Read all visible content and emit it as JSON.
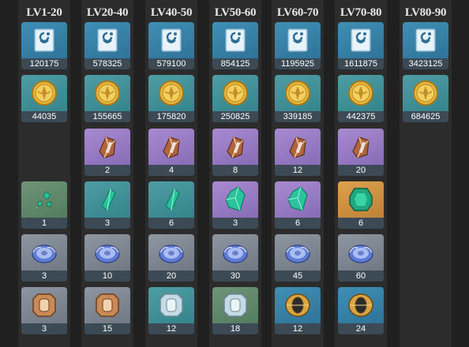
{
  "columns": [
    {
      "header": "LV1-20",
      "items": [
        {
          "row": 0,
          "icon": "exp-book-icon",
          "bg": "blue",
          "qty": "120175"
        },
        {
          "row": 1,
          "icon": "mora-coin-icon",
          "bg": "teal",
          "qty": "44035"
        },
        {
          "row": 3,
          "icon": "gem-sliver-icon",
          "bg": "green",
          "qty": "1"
        },
        {
          "row": 4,
          "icon": "nut-icon",
          "bg": "grey",
          "qty": "3"
        },
        {
          "row": 5,
          "icon": "guard-bronze-icon",
          "bg": "grey",
          "qty": "3"
        }
      ]
    },
    {
      "header": "LV20-40",
      "items": [
        {
          "row": 0,
          "icon": "exp-book-icon",
          "bg": "blue",
          "qty": "578325"
        },
        {
          "row": 1,
          "icon": "mora-coin-icon",
          "bg": "teal",
          "qty": "155665"
        },
        {
          "row": 2,
          "icon": "relic-ore-icon",
          "bg": "purple",
          "qty": "2"
        },
        {
          "row": 3,
          "icon": "gem-fragment-icon",
          "bg": "teal",
          "qty": "3"
        },
        {
          "row": 4,
          "icon": "nut-icon",
          "bg": "grey",
          "qty": "10"
        },
        {
          "row": 5,
          "icon": "guard-bronze-icon",
          "bg": "grey",
          "qty": "15"
        }
      ]
    },
    {
      "header": "LV40-50",
      "items": [
        {
          "row": 0,
          "icon": "exp-book-icon",
          "bg": "blue",
          "qty": "579100"
        },
        {
          "row": 1,
          "icon": "mora-coin-icon",
          "bg": "teal",
          "qty": "175820"
        },
        {
          "row": 2,
          "icon": "relic-ore-icon",
          "bg": "purple",
          "qty": "4"
        },
        {
          "row": 3,
          "icon": "gem-fragment-icon",
          "bg": "teal",
          "qty": "6"
        },
        {
          "row": 4,
          "icon": "nut-icon",
          "bg": "grey",
          "qty": "20"
        },
        {
          "row": 5,
          "icon": "guard-silver-icon",
          "bg": "teal",
          "qty": "12"
        }
      ]
    },
    {
      "header": "LV50-60",
      "items": [
        {
          "row": 0,
          "icon": "exp-book-icon",
          "bg": "blue",
          "qty": "854125"
        },
        {
          "row": 1,
          "icon": "mora-coin-icon",
          "bg": "teal",
          "qty": "250825"
        },
        {
          "row": 2,
          "icon": "relic-ore-icon",
          "bg": "purple",
          "qty": "8"
        },
        {
          "row": 3,
          "icon": "gem-chunk-icon",
          "bg": "purple",
          "qty": "3"
        },
        {
          "row": 4,
          "icon": "nut-icon",
          "bg": "grey",
          "qty": "30"
        },
        {
          "row": 5,
          "icon": "guard-silver-icon",
          "bg": "green",
          "qty": "18"
        }
      ]
    },
    {
      "header": "LV60-70",
      "items": [
        {
          "row": 0,
          "icon": "exp-book-icon",
          "bg": "blue",
          "qty": "1195925"
        },
        {
          "row": 1,
          "icon": "mora-coin-icon",
          "bg": "teal",
          "qty": "339185"
        },
        {
          "row": 2,
          "icon": "relic-ore-icon",
          "bg": "purple",
          "qty": "12"
        },
        {
          "row": 3,
          "icon": "gem-chunk-icon",
          "bg": "purple",
          "qty": "6"
        },
        {
          "row": 4,
          "icon": "nut-icon",
          "bg": "grey",
          "qty": "45"
        },
        {
          "row": 5,
          "icon": "guard-gold-icon",
          "bg": "blue",
          "qty": "12"
        }
      ]
    },
    {
      "header": "LV70-80",
      "items": [
        {
          "row": 0,
          "icon": "exp-book-icon",
          "bg": "blue",
          "qty": "1611875"
        },
        {
          "row": 1,
          "icon": "mora-coin-icon",
          "bg": "teal",
          "qty": "442375"
        },
        {
          "row": 2,
          "icon": "relic-ore-icon",
          "bg": "purple",
          "qty": "20"
        },
        {
          "row": 3,
          "icon": "gem-gemstone-icon",
          "bg": "gold",
          "qty": "6"
        },
        {
          "row": 4,
          "icon": "nut-icon",
          "bg": "grey",
          "qty": "60"
        },
        {
          "row": 5,
          "icon": "guard-gold-icon",
          "bg": "blue",
          "qty": "24"
        }
      ]
    },
    {
      "header": "LV80-90",
      "items": [
        {
          "row": 0,
          "icon": "exp-book-icon",
          "bg": "blue",
          "qty": "3423125"
        },
        {
          "row": 1,
          "icon": "mora-coin-icon",
          "bg": "teal",
          "qty": "684625"
        }
      ]
    }
  ]
}
